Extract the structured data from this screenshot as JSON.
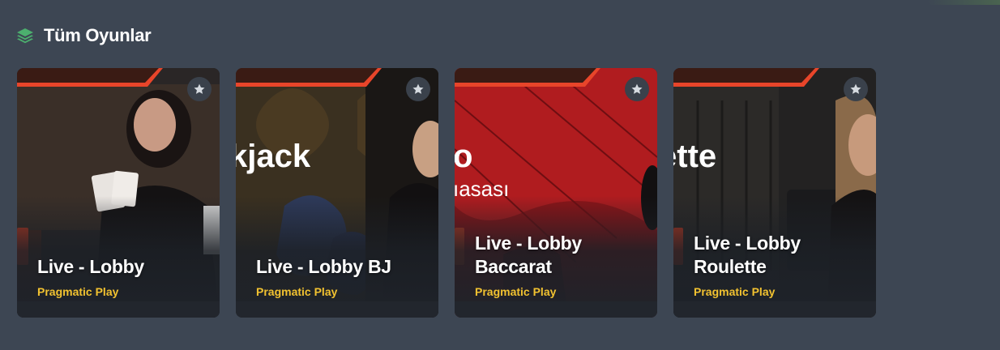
{
  "section": {
    "title": "Tüm Oyunlar",
    "icon": "layers-icon",
    "icon_color": "#4caf6e"
  },
  "cards": [
    {
      "title": "Live - Lobby",
      "provider": "Pragmatic Play",
      "art_text": "",
      "art_subtext": "",
      "icon": "star-icon"
    },
    {
      "title": "Live - Lobby BJ",
      "provider": "Pragmatic Play",
      "art_text": "kjack",
      "art_subtext": "",
      "icon": "star-icon"
    },
    {
      "title": "Live - Lobby Baccarat",
      "provider": "Pragmatic Play",
      "art_text": "o",
      "art_subtext": "ıasası",
      "icon": "star-icon"
    },
    {
      "title": "Live - Lobby Roulette",
      "provider": "Pragmatic Play",
      "art_text": "ette",
      "art_subtext": "",
      "icon": "star-icon"
    }
  ],
  "colors": {
    "page_bg": "#3d4653",
    "provider_text": "#f2c230",
    "card_stripe": "#e8452a"
  }
}
